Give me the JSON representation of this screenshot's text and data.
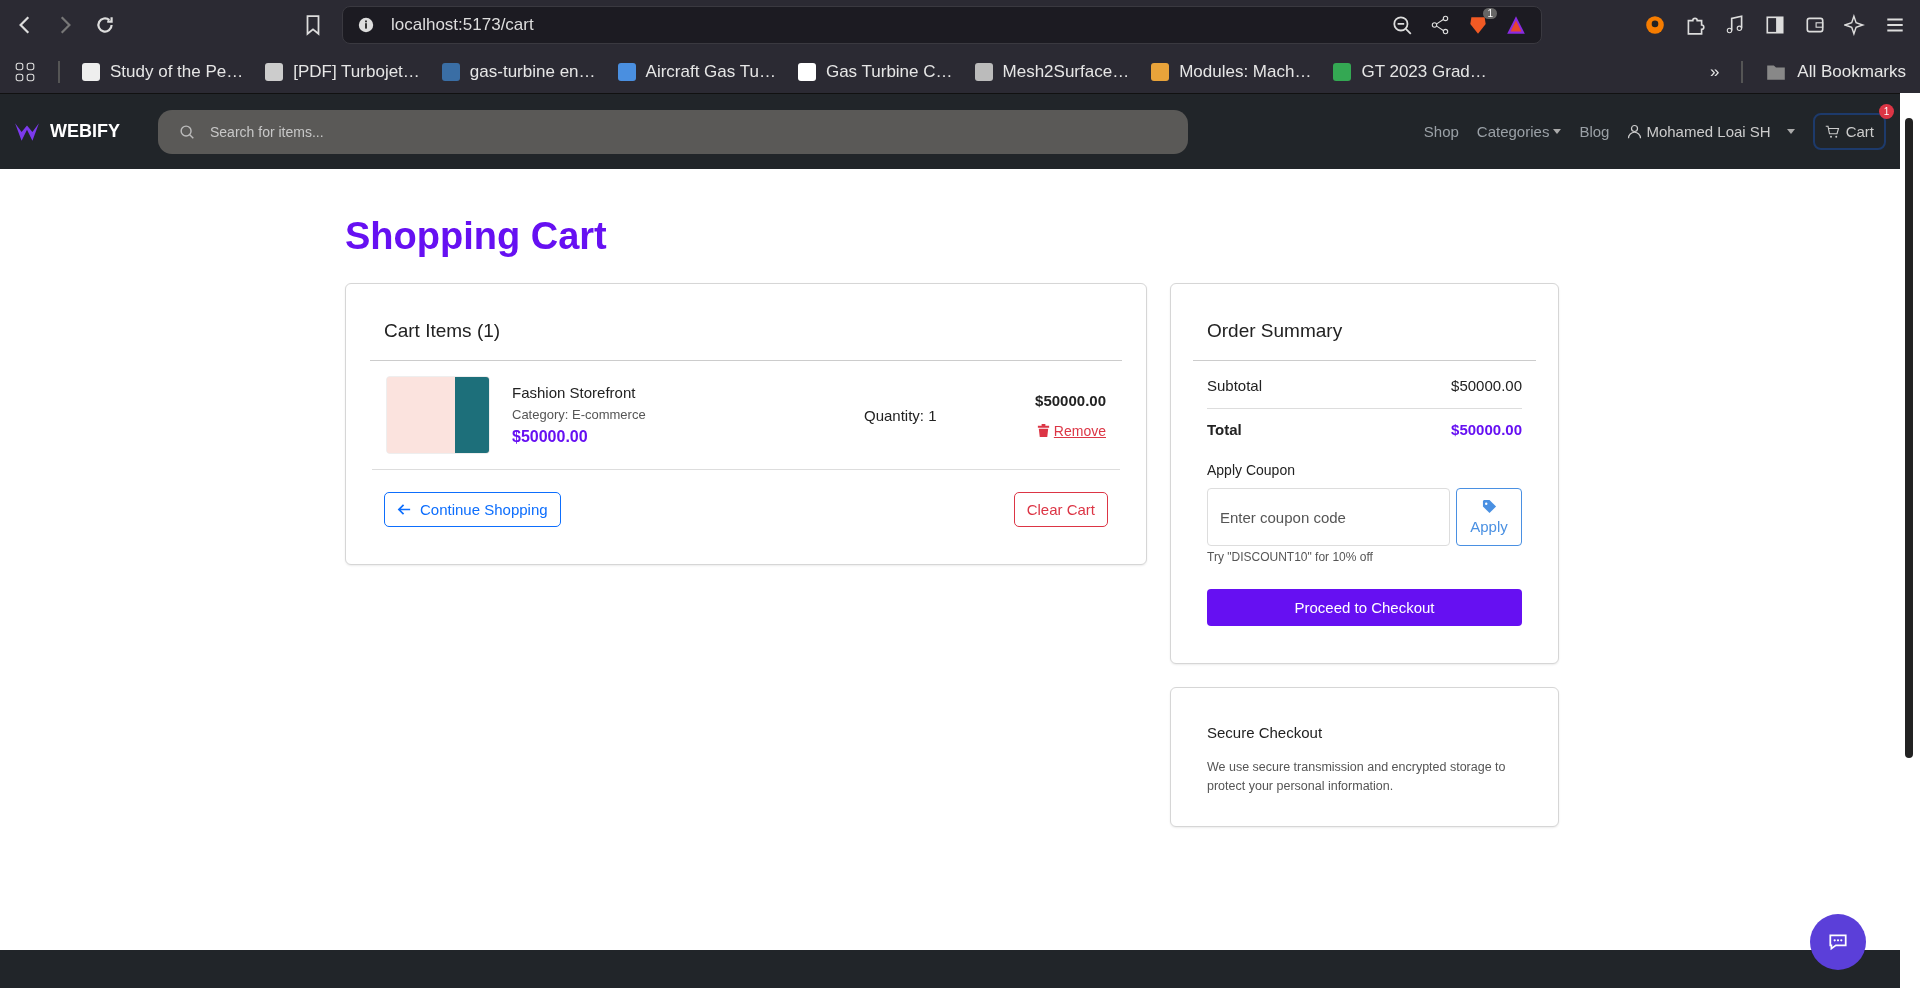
{
  "browser": {
    "url": "localhost:5173/cart",
    "shield_count": "1",
    "bookmarks": [
      {
        "label": "Study of the Pe…",
        "kind": "doc"
      },
      {
        "label": "[PDF] Turbojet…",
        "kind": "gem"
      },
      {
        "label": "gas-turbine en…",
        "kind": "badge"
      },
      {
        "label": "Aircraft Gas Tu…",
        "kind": "wing"
      },
      {
        "label": "Gas Turbine C…",
        "kind": "letter"
      },
      {
        "label": "Mesh2Surface…",
        "kind": "globe"
      },
      {
        "label": "Modules: Mach…",
        "kind": "tri"
      },
      {
        "label": "GT 2023 Grad…",
        "kind": "drive"
      }
    ],
    "overflow": "»",
    "all_bookmarks": "All Bookmarks"
  },
  "nav": {
    "brand": "WEBIFY",
    "search": {
      "placeholder": "Search for items..."
    },
    "links": [
      {
        "label": "Shop",
        "dropdown": false
      },
      {
        "label": "Categories",
        "dropdown": true
      },
      {
        "label": "Blog",
        "dropdown": false
      }
    ],
    "user": "Mohamed Loai SH",
    "cart": {
      "label": "Cart",
      "badge": "1"
    }
  },
  "title": "Shopping Cart",
  "cart": {
    "heading": "Cart Items (1)",
    "items": [
      {
        "name": "Fashion Storefront",
        "category": "Category: E-commerce",
        "price": "$50000.00",
        "quantity": "Quantity: 1",
        "line_total": "$50000.00",
        "remove": "Remove"
      }
    ],
    "continue": "Continue Shopping",
    "clear": "Clear Cart"
  },
  "summary": {
    "heading": "Order Summary",
    "rows": [
      {
        "label": "Subtotal",
        "value": "$50000.00",
        "kind": "plain"
      },
      {
        "label": "Total",
        "value": "$50000.00",
        "kind": "total"
      }
    ],
    "coupon_label": "Apply Coupon",
    "coupon": {
      "placeholder": "Enter coupon code"
    },
    "apply": "Apply",
    "hint": "Try \"DISCOUNT10\" for 10% off",
    "checkout": "Proceed to Checkout"
  },
  "secure": {
    "heading": "Secure Checkout",
    "text": "We use secure transmission and encrypted storage to protect your personal information."
  }
}
